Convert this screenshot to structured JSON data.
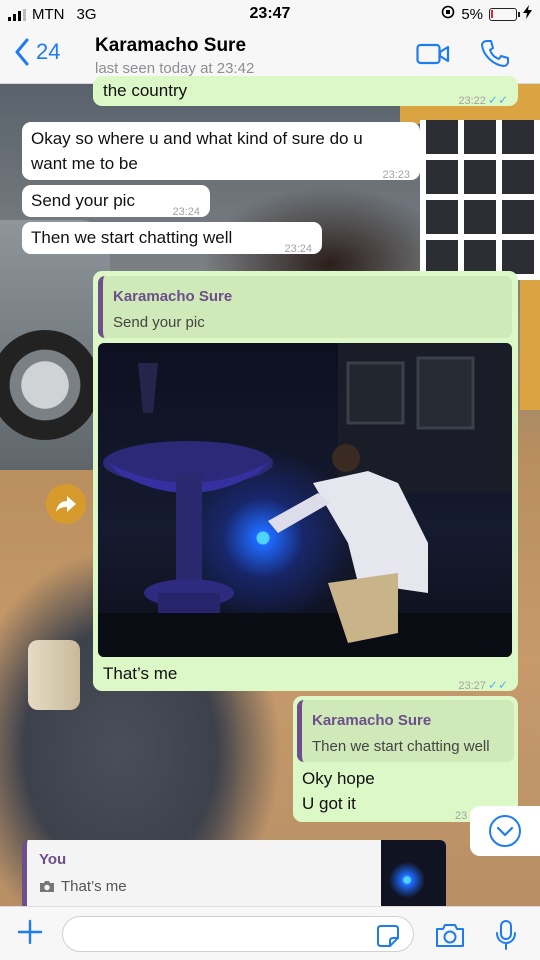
{
  "status_bar": {
    "carrier": "MTN",
    "network": "3G",
    "time": "23:47",
    "battery_percent": "5%",
    "battery_level": 0.05
  },
  "header": {
    "back_count": "24",
    "contact_name": "Karamacho Sure",
    "last_seen": "last seen today at 23:42",
    "accent_color": "#1e7cf2"
  },
  "messages": [
    {
      "dir": "out",
      "text": "the country",
      "time": "23:22",
      "read": true
    },
    {
      "dir": "in",
      "text_line1": "Okay so where u and what kind of sure do u",
      "text_line2": "want me to be",
      "time": "23:23"
    },
    {
      "dir": "in",
      "text": "Send your pic",
      "time": "23:24"
    },
    {
      "dir": "in",
      "text": "Then we start chatting well",
      "time": "23:24"
    },
    {
      "dir": "out",
      "quote_name": "Karamacho Sure",
      "quote_text": "Send your pic",
      "caption": "That’s me",
      "time": "23:27",
      "read": true,
      "media": "photo"
    },
    {
      "dir": "out",
      "quote_name": "Karamacho Sure",
      "quote_text": "Then we start chatting well",
      "text_line1": "Oky hope",
      "text_line2": "U got it",
      "time": "23"
    }
  ],
  "reply_preview": {
    "name": "You",
    "text": "That’s me",
    "icon": "camera-icon"
  },
  "input": {
    "placeholder": ""
  },
  "icons": [
    "back-chevron-icon",
    "video-call-icon",
    "phone-icon",
    "forward-icon",
    "chevron-down-icon",
    "plus-icon",
    "sticker-icon",
    "camera-icon",
    "microphone-icon"
  ],
  "colors": {
    "outgoing_bubble": "#dcf8c6",
    "incoming_bubble": "#ffffff",
    "quote_accent": "#6c4f8b",
    "read_tick": "#4fb6ec",
    "forward_button": "#d69a2d"
  }
}
